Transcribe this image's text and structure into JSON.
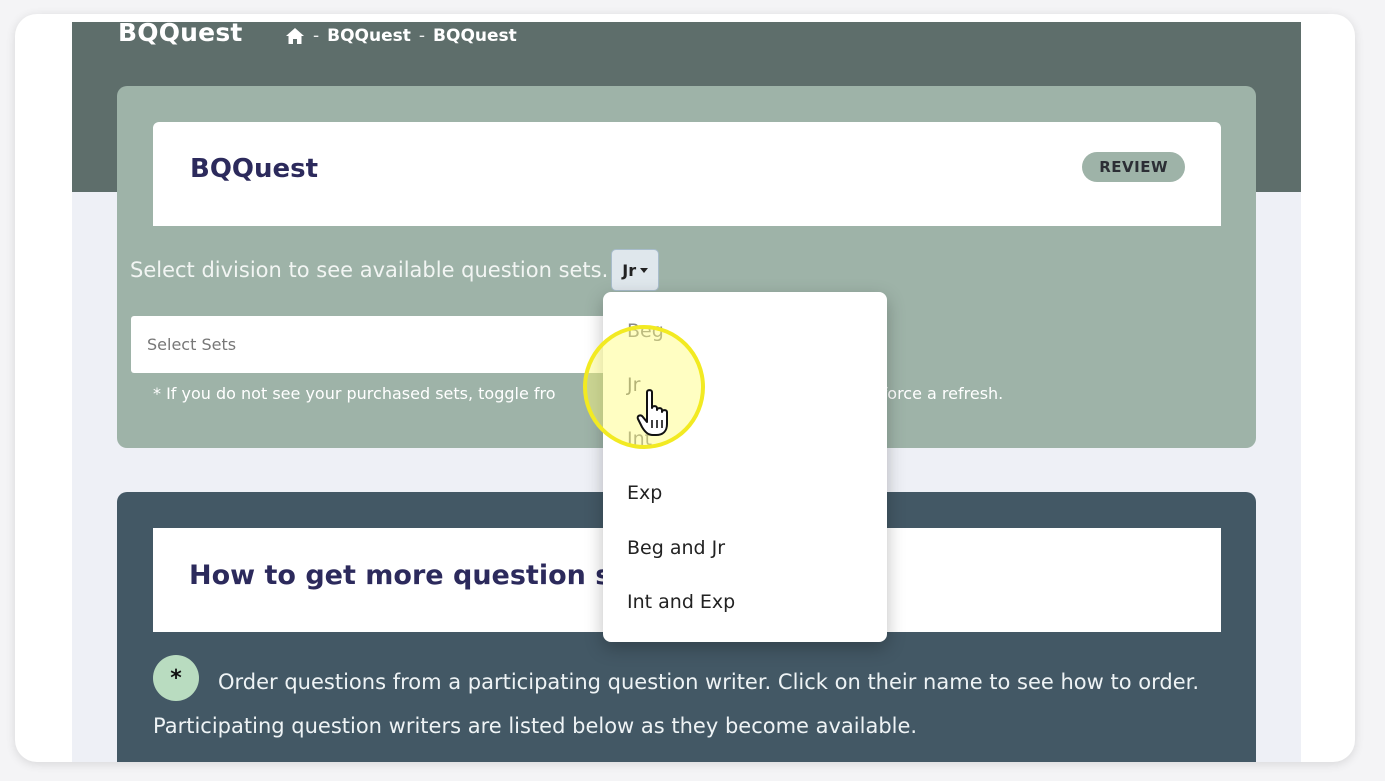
{
  "header": {
    "brand": "BQQuest",
    "breadcrumb": [
      "BQQuest",
      "BQQuest"
    ],
    "separator": "-",
    "home_icon": "home-icon"
  },
  "main_card": {
    "title": "BQQuest",
    "badge": "REVIEW"
  },
  "division": {
    "label": "Select division to see available question sets.",
    "selected": "Jr",
    "options": [
      "Beg",
      "Jr",
      "Int",
      "Exp",
      "Beg and Jr",
      "Int and Exp"
    ]
  },
  "sets_select": {
    "placeholder": "Select Sets"
  },
  "hint": {
    "left": "* If you do not see your purchased sets, toggle fro",
    "right": "ack to force a refresh."
  },
  "more_sets": {
    "title": "How to get more question se",
    "bullet": "*",
    "text": "Order questions from a participating question writer. Click on their name to see how to order. Participating question writers are listed below as they become available."
  },
  "colors": {
    "hero": "#5e6e6b",
    "panel": "#9eb3a8",
    "panel2": "#435865",
    "title": "#2c2a5c",
    "highlight": "#f2ea22"
  }
}
